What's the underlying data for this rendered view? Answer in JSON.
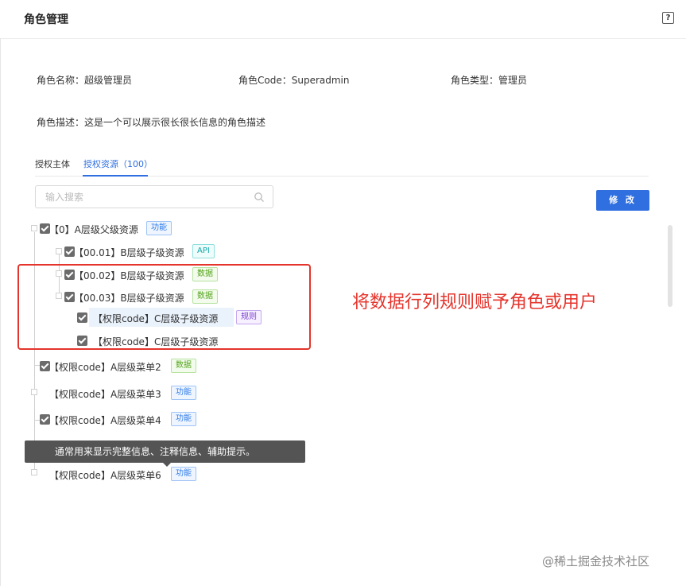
{
  "header": {
    "title": "角色管理",
    "help_icon": "?"
  },
  "info": {
    "name_label": "角色名称：",
    "name_value": "超级管理员",
    "code_label": "角色Code：",
    "code_value": "Superadmin",
    "type_label": "角色类型：",
    "type_value": "管理员",
    "desc_label": "角色描述：",
    "desc_value": "这是一个可以展示很长很长信息的角色描述"
  },
  "tabs": [
    {
      "label": "授权主体",
      "active": false
    },
    {
      "label": "授权资源（100）",
      "active": true
    }
  ],
  "search": {
    "placeholder": "输入搜索",
    "icon": "search-icon"
  },
  "edit_button": "修 改",
  "tree": [
    {
      "label": "【0】A层级父级资源",
      "tag": "功能",
      "tag_color": "#2f7be8",
      "checked": true
    },
    {
      "label": "【00.01】B层级子级资源",
      "tag": "API",
      "tag_color": "#13a8a8",
      "checked": true
    },
    {
      "label": "【00.02】B层级子级资源",
      "tag": "数据",
      "tag_color": "#52a41a",
      "checked": true
    },
    {
      "label": "【00.03】B层级子级资源",
      "tag": "数据",
      "tag_color": "#52a41a",
      "checked": true
    },
    {
      "label": "【权限code】C层级子级资源",
      "tag": "规则",
      "tag_color": "#7a3fd0",
      "checked": true
    },
    {
      "label": "【权限code】C层级子级资源",
      "tag": "",
      "checked": true
    },
    {
      "label": "【权限code】A层级菜单2",
      "tag": "数据",
      "tag_color": "#52a41a",
      "checked": true
    },
    {
      "label": "【权限code】A层级菜单3",
      "tag": "功能",
      "tag_color": "#2f7be8",
      "checked": false
    },
    {
      "label": "【权限code】A层级菜单4",
      "tag": "功能",
      "tag_color": "#2f7be8",
      "checked": true
    },
    {
      "label": "【权限code】A层级菜单6",
      "tag": "功能",
      "tag_color": "#2f7be8",
      "checked": false
    }
  ],
  "annotation": "将数据行列规则赋予角色或用户",
  "tooltip": "通常用来显示完整信息、注释信息、辅助提示。",
  "watermark": "@稀土掘金技术社区"
}
